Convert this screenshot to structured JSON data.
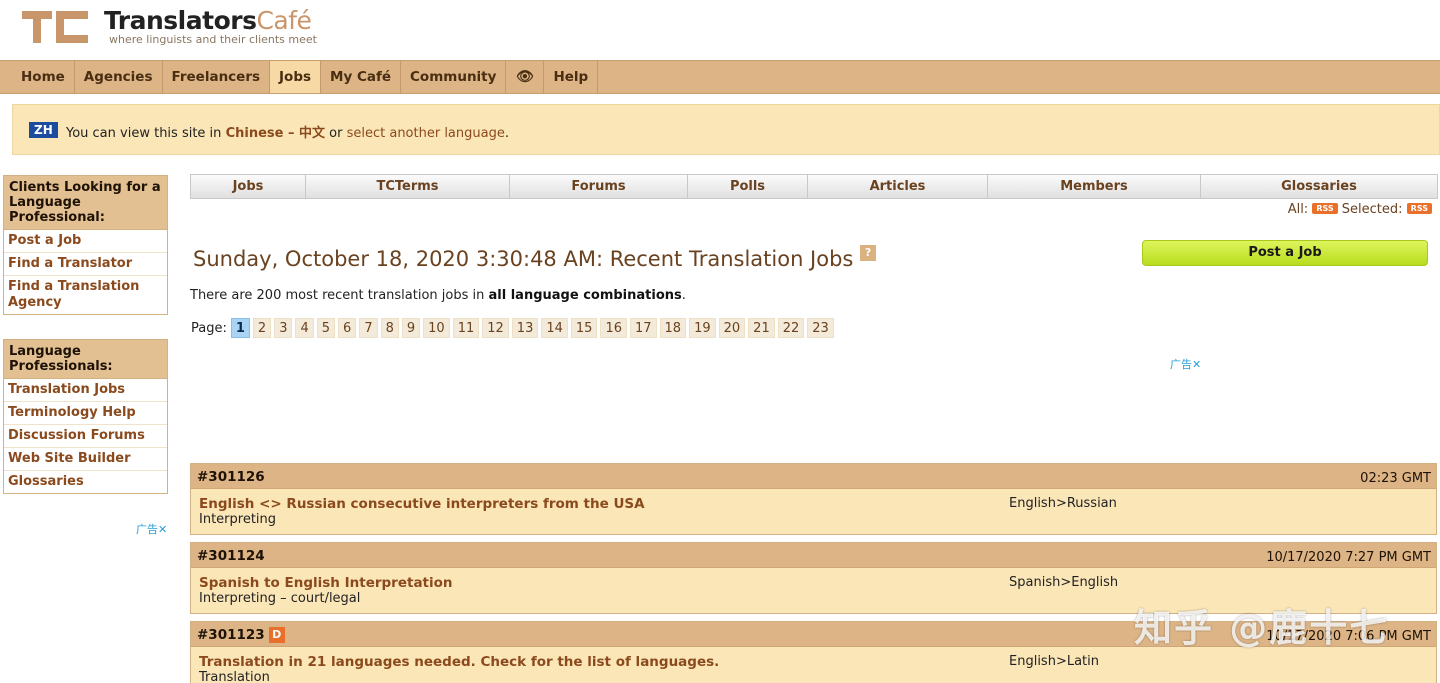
{
  "logo": {
    "mark": "TC",
    "title_main": "Translators",
    "title_accent": "Café",
    "tagline": "where linguists and their clients meet"
  },
  "topnav": {
    "items": [
      "Home",
      "Agencies",
      "Freelancers",
      "Jobs",
      "My Café",
      "Community",
      "Help"
    ],
    "eye_icon": "👁",
    "active": "Jobs"
  },
  "lang_banner": {
    "badge": "ZH",
    "prefix": "You can view this site in",
    "language": "Chinese – 中文",
    "middle": "or",
    "select_link": "select another language",
    "suffix": "."
  },
  "sidebar": {
    "clients_head": "Clients Looking for a Language Professional:",
    "clients_links": [
      "Post a Job",
      "Find a Translator",
      "Find a Translation Agency"
    ],
    "pros_head": "Language Professionals:",
    "pros_links": [
      "Translation Jobs",
      "Terminology Help",
      "Discussion Forums",
      "Web Site Builder",
      "Glossaries"
    ],
    "ad_label": "广告✕"
  },
  "subtabs": [
    "Jobs",
    "TCTerms",
    "Forums",
    "Polls",
    "Articles",
    "Members",
    "Glossaries"
  ],
  "rss": {
    "all_label": "All:",
    "selected_label": "Selected:",
    "badge": "RSS"
  },
  "headline": {
    "text": "Sunday, October 18, 2020 3:30:48 AM: Recent Translation Jobs",
    "help": "?"
  },
  "post_job_button": "Post a Job",
  "summary": {
    "prefix": "There are 200 most recent translation jobs in",
    "bold": "all language combinations",
    "suffix": "."
  },
  "pager": {
    "label": "Page:",
    "current": "1",
    "pages": [
      "2",
      "3",
      "4",
      "5",
      "6",
      "7",
      "8",
      "9",
      "10",
      "11",
      "12",
      "13",
      "14",
      "15",
      "16",
      "17",
      "18",
      "19",
      "20",
      "21",
      "22",
      "23"
    ]
  },
  "ad_main_label": "广告✕",
  "jobs": [
    {
      "id": "#301126",
      "badge": "",
      "time": "02:23 GMT",
      "title": "English <> Russian consecutive interpreters from the USA",
      "category": "Interpreting",
      "pair": "English>Russian"
    },
    {
      "id": "#301124",
      "badge": "",
      "time": "10/17/2020 7:27 PM GMT",
      "title": "Spanish to English Interpretation",
      "category": "Interpreting – court/legal",
      "pair": "Spanish>English"
    },
    {
      "id": "#301123",
      "badge": "D",
      "time": "10/17/2020 7:06 PM GMT",
      "title": "Translation in 21 languages needed. Check for the list of languages.",
      "category": "Translation",
      "pair": "English>Latin"
    }
  ],
  "watermark": "知乎 @鹿十七"
}
